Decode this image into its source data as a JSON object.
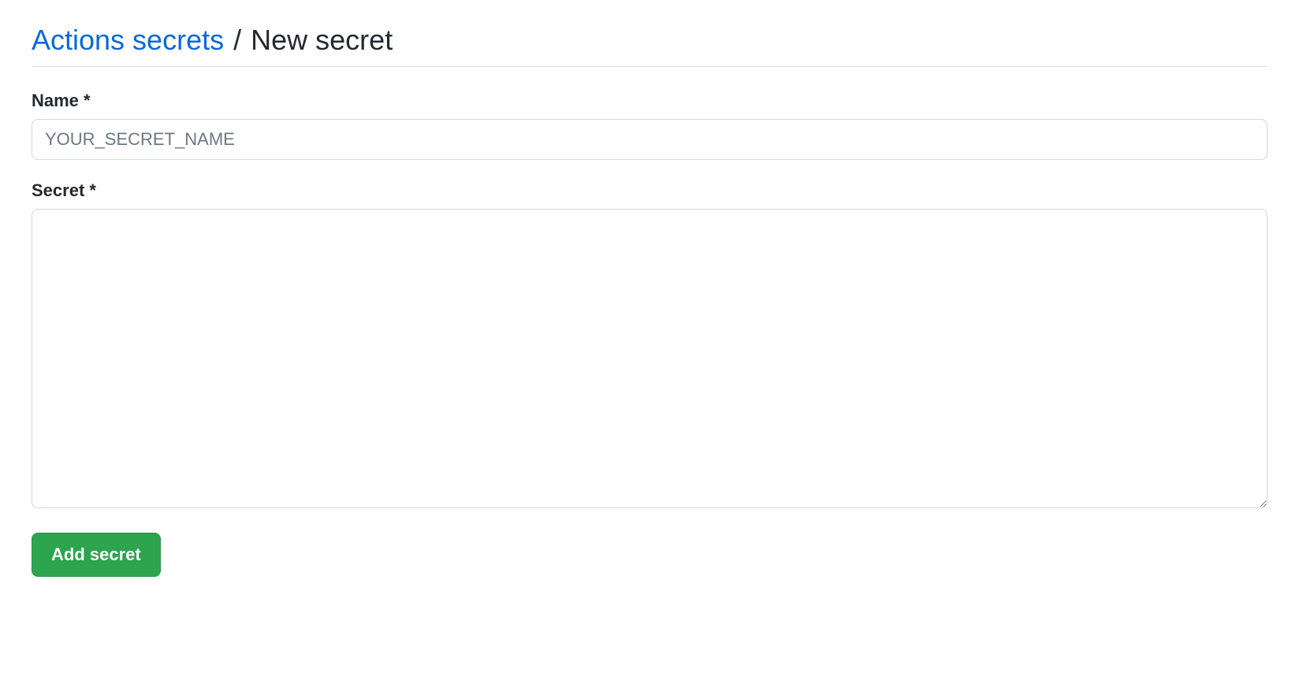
{
  "breadcrumb": {
    "link_text": "Actions secrets",
    "separator": "/",
    "current": "New secret"
  },
  "form": {
    "name": {
      "label": "Name *",
      "placeholder": "YOUR_SECRET_NAME",
      "value": ""
    },
    "secret": {
      "label": "Secret *",
      "value": ""
    },
    "submit_label": "Add secret"
  }
}
